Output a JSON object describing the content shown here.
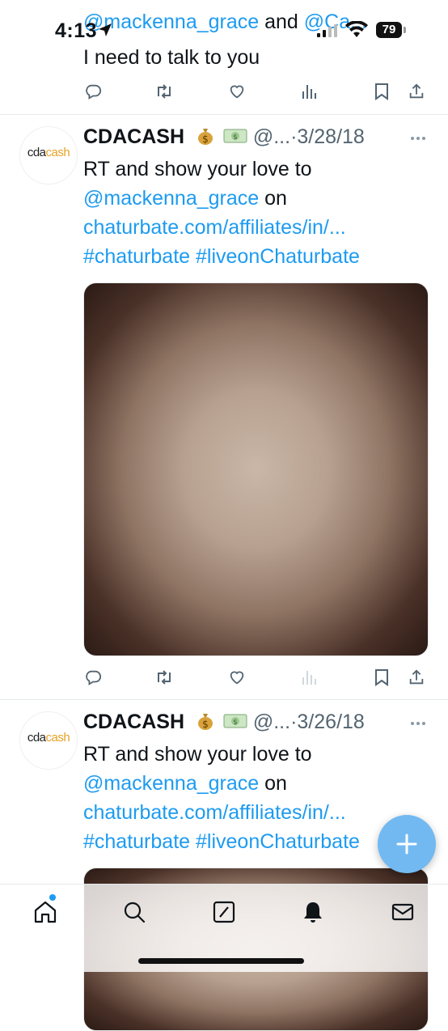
{
  "status_bar": {
    "time": "4:13",
    "battery": "79"
  },
  "top_tweet": {
    "line1_mentions": "@mackenna_grace",
    "line1_and": " and ",
    "line1_mention2": "@Ca...",
    "line2": "I need to talk to you"
  },
  "tweets": [
    {
      "name": "CDACASH",
      "handle": "@...",
      "dot": "·",
      "date": "3/28/18",
      "avatar_text_a": "cda",
      "avatar_text_b": "cash",
      "text_line1": "RT and show your love to",
      "mention": "@mackenna_grace",
      "on": " on",
      "link": "chaturbate.com/affiliates/in/...",
      "hashtag1": "#chaturbate",
      "hashtag2": "#liveonChaturbate"
    },
    {
      "name": "CDACASH",
      "handle": "@...",
      "dot": "·",
      "date": "3/26/18",
      "avatar_text_a": "cda",
      "avatar_text_b": "cash",
      "text_line1": "RT and show your love to",
      "mention": "@mackenna_grace",
      "on": " on",
      "link": "chaturbate.com/affiliates/in/...",
      "hashtag1": "#chaturbate",
      "hashtag2": "#liveonChaturbate"
    }
  ],
  "icons": {
    "reply": "reply-icon",
    "retweet": "retweet-icon",
    "like": "heart-icon",
    "views": "views-icon",
    "bookmark": "bookmark-icon",
    "share": "share-icon"
  },
  "tabs": [
    "home",
    "search",
    "grok",
    "notifications",
    "messages"
  ],
  "colors": {
    "accent": "#1d9bf0",
    "fab": "#72b9f2",
    "text": "#0f1419",
    "secondary": "#536471"
  }
}
